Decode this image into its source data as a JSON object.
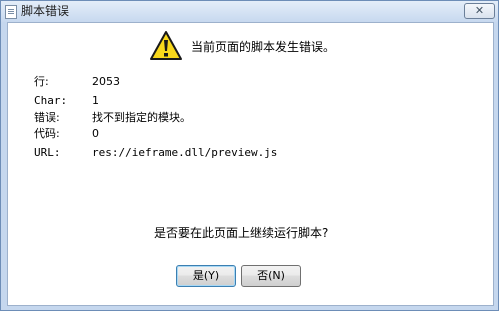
{
  "window": {
    "title": "脚本错误",
    "close_label": "✕"
  },
  "icons": {
    "title": "document-icon",
    "warning": "warning-icon"
  },
  "dialog": {
    "headline": "当前页面的脚本发生错误。",
    "fields": [
      {
        "label": "行:",
        "value": "2053"
      },
      {
        "label": "Char:",
        "value": "1"
      },
      {
        "label": "错误:",
        "value": "找不到指定的模块。"
      },
      {
        "label": "代码:",
        "value": "0"
      },
      {
        "label": "URL:",
        "value": "res://ieframe.dll/preview.js"
      }
    ],
    "question": "是否要在此页面上继续运行脚本?"
  },
  "buttons": {
    "yes": "是(Y)",
    "no": "否(N)"
  },
  "colors": {
    "titlebar": "#c7d9ef",
    "warning": "#f8d81c",
    "frame": "#6d8db7"
  }
}
